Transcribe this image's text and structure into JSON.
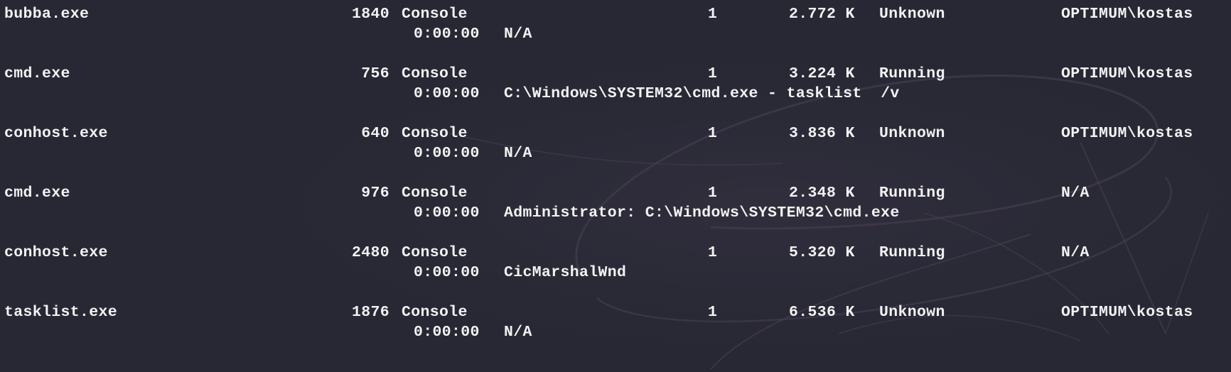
{
  "wallpaper": {
    "background_color": "#272834",
    "accent_color": "#4a3f55"
  },
  "tasklist": {
    "rows": [
      {
        "image_name": "bubba.exe",
        "pid": "1840",
        "session_name": "Console",
        "session_num": "1",
        "mem_usage": "2.772 K",
        "status": "Unknown",
        "user_name": "OPTIMUM\\kostas",
        "cpu_time": "0:00:00",
        "window_title": "N/A"
      },
      {
        "image_name": "cmd.exe",
        "pid": "756",
        "session_name": "Console",
        "session_num": "1",
        "mem_usage": "3.224 K",
        "status": "Running",
        "user_name": "OPTIMUM\\kostas",
        "cpu_time": "0:00:00",
        "window_title": "C:\\Windows\\SYSTEM32\\cmd.exe - tasklist  /v"
      },
      {
        "image_name": "conhost.exe",
        "pid": "640",
        "session_name": "Console",
        "session_num": "1",
        "mem_usage": "3.836 K",
        "status": "Unknown",
        "user_name": "OPTIMUM\\kostas",
        "cpu_time": "0:00:00",
        "window_title": "N/A"
      },
      {
        "image_name": "cmd.exe",
        "pid": "976",
        "session_name": "Console",
        "session_num": "1",
        "mem_usage": "2.348 K",
        "status": "Running",
        "user_name": "N/A",
        "cpu_time": "0:00:00",
        "window_title": "Administrator: C:\\Windows\\SYSTEM32\\cmd.exe"
      },
      {
        "image_name": "conhost.exe",
        "pid": "2480",
        "session_name": "Console",
        "session_num": "1",
        "mem_usage": "5.320 K",
        "status": "Running",
        "user_name": "N/A",
        "cpu_time": "0:00:00",
        "window_title": "CicMarshalWnd"
      },
      {
        "image_name": "tasklist.exe",
        "pid": "1876",
        "session_name": "Console",
        "session_num": "1",
        "mem_usage": "6.536 K",
        "status": "Unknown",
        "user_name": "OPTIMUM\\kostas",
        "cpu_time": "0:00:00",
        "window_title": "N/A"
      }
    ]
  }
}
